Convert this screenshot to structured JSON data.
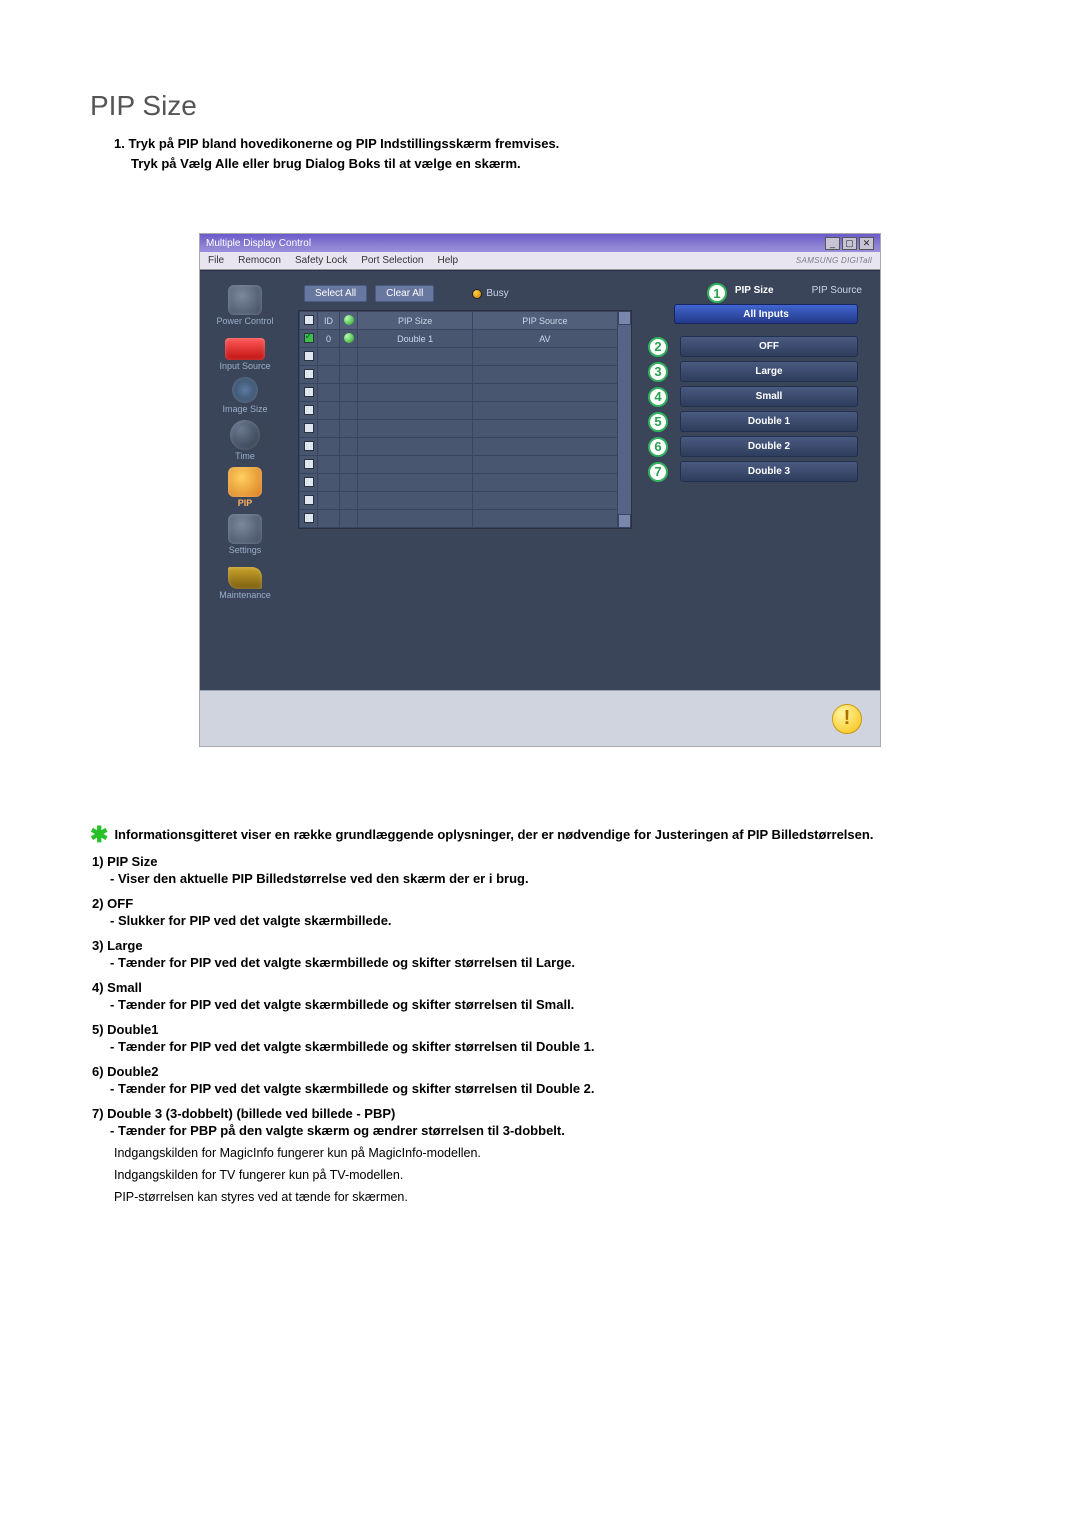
{
  "page": {
    "title": "PIP Size",
    "intro_num": "1.",
    "intro_line1": "Tryk på PIP bland hovedikonerne og PIP Indstillingsskærm fremvises.",
    "intro_line2": "Tryk på Vælg Alle eller brug Dialog Boks til at vælge en skærm."
  },
  "window": {
    "title": "Multiple Display Control",
    "menu": {
      "file": "File",
      "remocon": "Remocon",
      "safety": "Safety Lock",
      "port": "Port Selection",
      "help": "Help"
    },
    "brand": "SAMSUNG DIGITall"
  },
  "sidebar": {
    "items": [
      {
        "label": "Power Control"
      },
      {
        "label": "Input Source"
      },
      {
        "label": "Image Size"
      },
      {
        "label": "Time"
      },
      {
        "label": "PIP"
      },
      {
        "label": "Settings"
      },
      {
        "label": "Maintenance"
      }
    ]
  },
  "controls": {
    "select_all": "Select All",
    "clear_all": "Clear All",
    "busy": "Busy"
  },
  "grid": {
    "headers": {
      "id": "ID",
      "size": "PIP Size",
      "source": "PIP Source"
    },
    "row0": {
      "id": "0",
      "size": "Double 1",
      "source": "AV"
    }
  },
  "right": {
    "tab_size": "PIP Size",
    "tab_source": "PIP Source",
    "all_inputs": "All Inputs",
    "buttons": {
      "off": "OFF",
      "large": "Large",
      "small": "Small",
      "d1": "Double 1",
      "d2": "Double 2",
      "d3": "Double 3"
    }
  },
  "notes": {
    "star": "Informationsgitteret viser en række grundlæggende oplysninger, der er nødvendige for Justeringen af PIP Billedstørrelsen.",
    "i1_t": "1)  PIP Size",
    "i1_s": "- Viser den aktuelle PIP Billedstørrelse ved den skærm der er i brug.",
    "i2_t": "2)  OFF",
    "i2_s": "- Slukker for PIP ved det valgte skærmbillede.",
    "i3_t": "3)  Large",
    "i3_s": "- Tænder for PIP ved det valgte skærmbillede og skifter størrelsen til Large.",
    "i4_t": "4)  Small",
    "i4_s": "- Tænder for PIP ved det valgte skærmbillede og skifter størrelsen til Small.",
    "i5_t": "5)  Double1",
    "i5_s": "- Tænder for PIP ved det valgte skærmbillede og skifter størrelsen til Double 1.",
    "i6_t": "6)  Double2",
    "i6_s": "- Tænder for PIP ved det valgte skærmbillede og skifter størrelsen til Double 2.",
    "i7_t": "7)  Double 3 (3-dobbelt) (billede ved billede - PBP)",
    "i7_s": "- Tænder for PBP på den valgte skærm og ændrer størrelsen til 3-dobbelt.",
    "p1": "Indgangskilden for MagicInfo fungerer kun på MagicInfo-modellen.",
    "p2": "Indgangskilden for TV fungerer kun på TV-modellen.",
    "p3": "PIP-størrelsen kan styres ved at tænde for skærmen."
  }
}
